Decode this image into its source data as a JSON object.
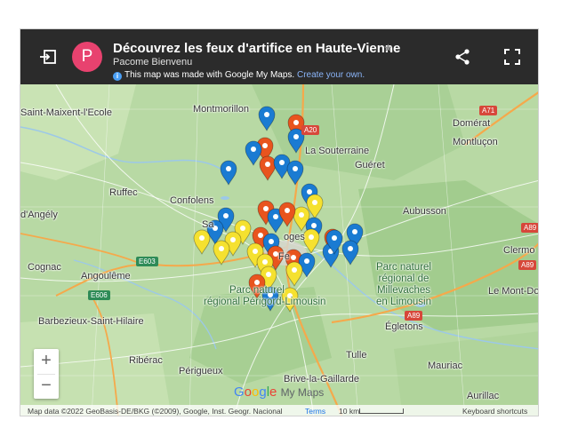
{
  "header": {
    "avatar_letter": "P",
    "title": "Découvrez les feux d'artifice en Haute-Vienne",
    "author": "Pacome Bienvenu",
    "info_text": "This map was made with Google My Maps.",
    "info_link": "Create your own."
  },
  "map": {
    "places": {
      "saint_maixent": "Saint-Maixent-l'Ecole",
      "montmorillon": "Montmorillon",
      "domerat": "Domérat",
      "montlucon": "Montluçon",
      "la_souterraine": "La Souterraine",
      "gueret": "Guéret",
      "ruffec": "Ruffec",
      "confolens": "Confolens",
      "angely": "d'Angély",
      "aubusson": "Aubusson",
      "cognac": "Cognac",
      "angouleme": "Angoulême",
      "clermont": "Clermo",
      "le_mont_dore": "Le Mont-Dore",
      "barbezieux": "Barbezieux-Saint-Hilaire",
      "egletons": "Égletons",
      "riberac": "Ribérac",
      "tulle": "Tulle",
      "mauriac": "Mauriac",
      "perigueux": "Périgueux",
      "brive": "Brive-la-Gaillarde",
      "aurillac": "Aurillac",
      "limoges_fragment": "oges",
      "sa_fragment": "Sa",
      "fe_fragment": "Fe"
    },
    "parks": {
      "perigord": "Parc naturel\nrégional Périgord-Limousin",
      "millevaches": "Parc naturel\nrégional de\nMillevaches\nen Limousin"
    },
    "roads": [
      "A71",
      "E603",
      "E606",
      "A89",
      "A89",
      "A89",
      "A20"
    ],
    "colors": {
      "red_marker": "#e8541e",
      "blue_marker": "#1a7bd2",
      "yellow_marker": "#f5e130",
      "land": "#b8d9a4",
      "water": "#9cc8e8",
      "motorway": "#f5a94b"
    },
    "markers": [
      {
        "color": "blue"
      },
      {
        "color": "red"
      },
      {
        "color": "red"
      },
      {
        "color": "blue"
      },
      {
        "color": "blue"
      },
      {
        "color": "red"
      },
      {
        "color": "blue"
      },
      {
        "color": "blue"
      },
      {
        "color": "blue"
      },
      {
        "color": "blue"
      },
      {
        "color": "red"
      },
      {
        "color": "yellow"
      },
      {
        "color": "blue"
      },
      {
        "color": "yellow"
      },
      {
        "color": "red"
      },
      {
        "color": "blue"
      },
      {
        "color": "blue"
      },
      {
        "color": "yellow"
      },
      {
        "color": "blue"
      },
      {
        "color": "yellow"
      },
      {
        "color": "yellow"
      },
      {
        "color": "yellow"
      },
      {
        "color": "red"
      },
      {
        "color": "blue"
      },
      {
        "color": "red"
      },
      {
        "color": "yellow"
      },
      {
        "color": "red"
      },
      {
        "color": "blue"
      },
      {
        "color": "yellow"
      },
      {
        "color": "yellow"
      },
      {
        "color": "blue"
      },
      {
        "color": "blue"
      },
      {
        "color": "yellow"
      },
      {
        "color": "red"
      },
      {
        "color": "blue"
      },
      {
        "color": "yellow"
      },
      {
        "color": "red"
      },
      {
        "color": "blue"
      },
      {
        "color": "blue"
      },
      {
        "color": "yellow"
      }
    ]
  },
  "controls": {
    "zoom_in": "+",
    "zoom_out": "−"
  },
  "logo": {
    "google": "Google",
    "my_maps": "My Maps"
  },
  "footer": {
    "attribution": "Map data ©2022 GeoBasis-DE/BKG (©2009), Google, Inst. Geogr. Nacional",
    "terms": "Terms",
    "scale": "10 km",
    "shortcuts": "Keyboard shortcuts"
  }
}
